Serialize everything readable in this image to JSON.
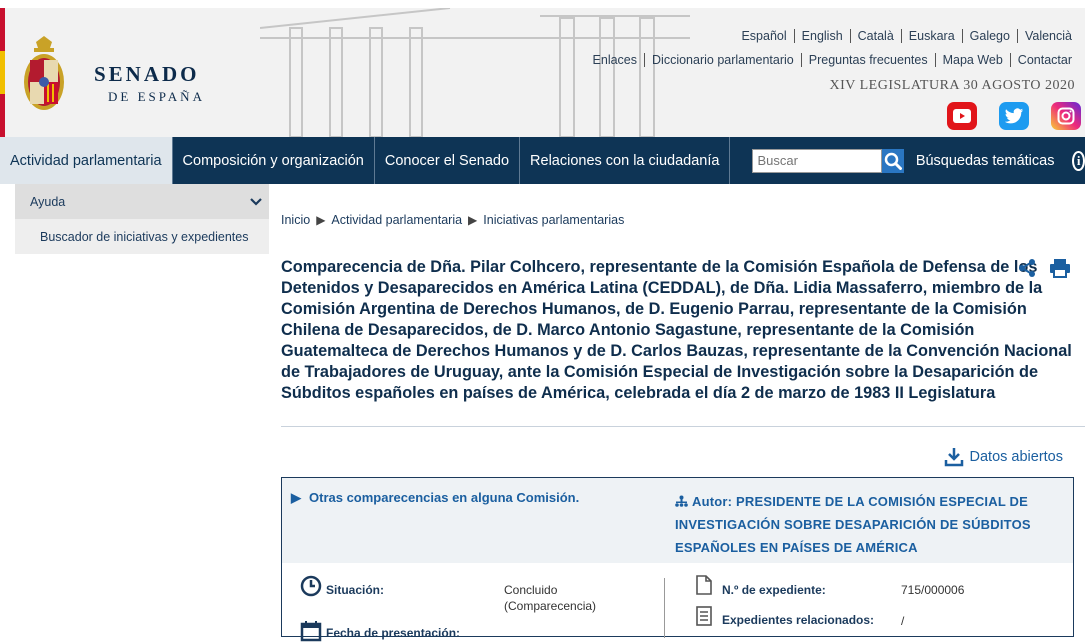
{
  "header": {
    "brand_name": "SENADO",
    "brand_sub": "DE ESPAÑA",
    "languages": [
      "Español",
      "English",
      "Català",
      "Euskara",
      "Galego",
      "Valencià"
    ],
    "utility_links": [
      "Enlaces",
      "Diccionario parlamentario",
      "Preguntas frecuentes",
      "Mapa Web",
      "Contactar"
    ],
    "legislature_date": "XIV LEGISLATURA 30 AGOSTO 2020",
    "social": [
      "youtube-icon",
      "twitter-icon",
      "instagram-icon"
    ],
    "colors": {
      "red": "#c8102e",
      "yellow": "#f1bf00"
    }
  },
  "nav": {
    "items": [
      "Actividad parlamentaria",
      "Composición y organización",
      "Conocer el Senado",
      "Relaciones con la ciudadanía"
    ],
    "active_index": 0,
    "search_placeholder": "Buscar",
    "topics": "Búsquedas temáticas",
    "colors": {
      "bar": "#0e3455",
      "active": "#dfe6ec",
      "search_button": "#2a76c2"
    }
  },
  "sidebar": {
    "section": "Ayuda",
    "items": [
      "Buscador de iniciativas y expedientes"
    ]
  },
  "breadcrumb": [
    "Inicio",
    "Actividad parlamentaria",
    "Iniciativas parlamentarias"
  ],
  "title": "Comparecencia de Dña. Pilar Colhcero, representante de la Comisión Española de Defensa de los Detenidos y Desaparecidos en América Latina (CEDDAL), de Dña. Lidia Massaferro, miembro de la Comisión Argentina de Derechos Humanos, de D. Eugenio Parrau, representante de la Comisión Chilena de Desaparecidos, de D. Marco Antonio Sagastune, representante de la Comisión Guatemalteca de Derechos Humanos y de D. Carlos Bauzas, representante de la Convención Nacional de Trabajadores de Uruguay, ante la Comisión Especial de Investigación sobre la Desaparición de Súbditos españoles en países de América, celebrada el día 2 de marzo de 1983 II Legislatura",
  "open_data": "Datos abiertos",
  "panel": {
    "other": "Otras comparecencias en alguna Comisión.",
    "author": "Autor: PRESIDENTE DE LA COMISIÓN ESPECIAL DE INVESTIGACIÓN SOBRE DESAPARICIÓN DE SÚBDITOS ESPAÑOLES EN PAÍSES DE AMÉRICA",
    "situation_label": "Situación:",
    "situation_value": "Concluido (Comparecencia)",
    "presentation_label": "Fecha de presentación:",
    "expediente_label": "N.º de expediente:",
    "expediente_value": "715/000006",
    "related_label": "Expedientes relacionados:",
    "related_value": "/"
  }
}
